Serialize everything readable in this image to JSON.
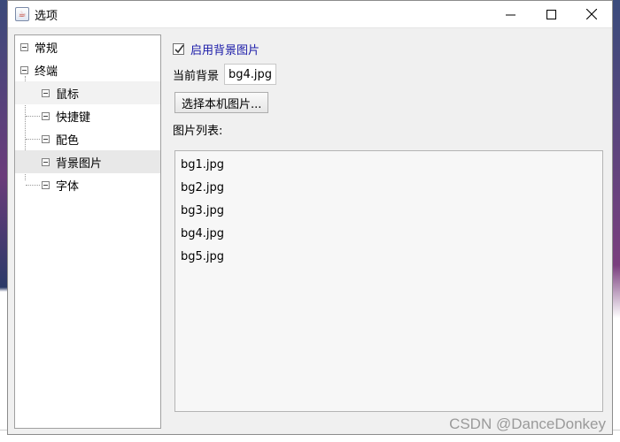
{
  "window": {
    "title": "选项",
    "minimize_glyph": "—",
    "maximize_glyph": "☐",
    "close_glyph": "✕",
    "icon": "java-cup-icon"
  },
  "tree": {
    "items": [
      {
        "label": "常规",
        "level": 0,
        "icon": "expander-icon"
      },
      {
        "label": "终端",
        "level": 0,
        "icon": "expander-icon"
      },
      {
        "label": "鼠标",
        "level": 1,
        "icon": "expander-icon"
      },
      {
        "label": "快捷键",
        "level": 1,
        "icon": "expander-icon"
      },
      {
        "label": "配色",
        "level": 1,
        "icon": "expander-icon"
      },
      {
        "label": "背景图片",
        "level": 1,
        "icon": "expander-icon",
        "selected": true
      },
      {
        "label": "字体",
        "level": 1,
        "icon": "expander-icon"
      }
    ]
  },
  "background": {
    "enable_label": "启用背景图片",
    "enable_checked": true,
    "current_label": "当前背景",
    "current_value": "bg4.jpg",
    "choose_button": "选择本机图片...",
    "list_label": "图片列表:",
    "list_items": [
      "bg1.jpg",
      "bg2.jpg",
      "bg3.jpg",
      "bg4.jpg",
      "bg5.jpg"
    ]
  },
  "watermark": "CSDN @DanceDonkey",
  "colors": {
    "checkbox_label": "#1a1aa8",
    "selected_row": "#e8e8e8",
    "list_background": "#f7f7f7"
  }
}
